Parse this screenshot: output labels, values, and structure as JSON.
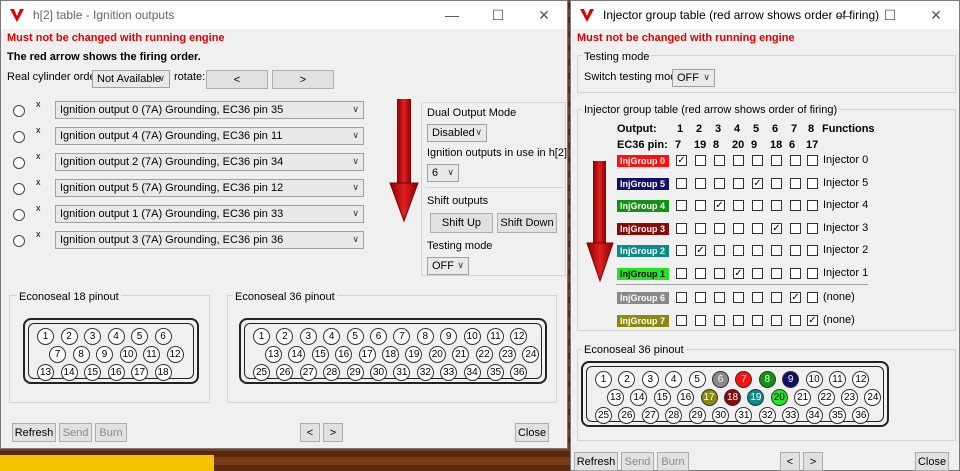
{
  "colors": {
    "warning": "#e00000",
    "arrow": "#c00000",
    "yellow": "#f4c400"
  },
  "left": {
    "title": "h[2] table - Ignition outputs",
    "warning": "Must not be changed with running engine",
    "firing_note": "The red arrow shows the firing order.",
    "real_cyl_label": "Real cylinder order:",
    "real_cyl_value": "Not Available",
    "rotate_label": "rotate:",
    "rotate_left": "<",
    "rotate_right": ">",
    "x_mark": "x",
    "outputs": [
      "Ignition output 0 (7A) Grounding, EC36 pin 35",
      "Ignition output 4 (7A) Grounding, EC36 pin 11",
      "Ignition output 2 (7A) Grounding, EC36 pin 34",
      "Ignition output 5 (7A) Grounding, EC36 pin 12",
      "Ignition output 1 (7A) Grounding, EC36 pin 33",
      "Ignition output 3 (7A) Grounding, EC36 pin 36"
    ],
    "dual_output_label": "Dual Output Mode",
    "dual_output_value": "Disabled",
    "outputs_in_use_label": "Ignition outputs in use in h[2]",
    "outputs_in_use_value": "6",
    "shift_label": "Shift outputs",
    "shift_up": "Shift Up",
    "shift_down": "Shift Down",
    "testing_label": "Testing mode",
    "testing_value": "OFF",
    "ec18_label": "Econoseal 18 pinout",
    "ec36_label": "Econoseal 36 pinout",
    "refresh": "Refresh",
    "send": "Send",
    "burn": "Burn",
    "prev": "<",
    "next": ">",
    "close": "Close"
  },
  "right": {
    "title": "Injector group table (red arrow shows order of firing)",
    "warning": "Must not be changed with running engine",
    "testing_group": "Testing mode",
    "switch_label": "Switch testing mode",
    "switch_value": "OFF",
    "table_group": "Injector group table (red arrow shows order of firing)",
    "output_label": "Output:",
    "pin_label": "EC36 pin:",
    "functions_label": "Functions",
    "outputs": [
      "1",
      "2",
      "3",
      "4",
      "5",
      "6",
      "7",
      "8"
    ],
    "pins": [
      "7",
      "19",
      "8",
      "20",
      "9",
      "18",
      "6",
      "17"
    ],
    "rows": [
      {
        "name": "InjGroup 0",
        "color": "#ff1010",
        "checked": 0,
        "func": "Injector 0"
      },
      {
        "name": "InjGroup 5",
        "color": "#10106a",
        "checked": 4,
        "func": "Injector 5"
      },
      {
        "name": "InjGroup 4",
        "color": "#129212",
        "checked": 2,
        "func": "Injector 4"
      },
      {
        "name": "InjGroup 3",
        "color": "#8a0a0a",
        "checked": 5,
        "func": "Injector 3"
      },
      {
        "name": "InjGroup 2",
        "color": "#0e8a8a",
        "checked": 1,
        "func": "Injector 2"
      },
      {
        "name": "InjGroup 1",
        "color": "#22e622",
        "checked": 3,
        "func": "Injector 1"
      },
      {
        "name": "InjGroup 6",
        "color": "#8a8a8a",
        "checked": 6,
        "func": "(none)"
      },
      {
        "name": "InjGroup 7",
        "color": "#8a8a10",
        "checked": 7,
        "func": "(none)"
      }
    ],
    "ec36_label": "Econoseal 36 pinout",
    "refresh": "Refresh",
    "send": "Send",
    "burn": "Burn",
    "prev": "<",
    "next": ">",
    "close": "Close"
  },
  "ec18_pins": [
    "1",
    "2",
    "3",
    "4",
    "5",
    "6",
    "7",
    "8",
    "9",
    "10",
    "11",
    "12",
    "13",
    "14",
    "15",
    "16",
    "17",
    "18"
  ],
  "ec36_pins": [
    "1",
    "2",
    "3",
    "4",
    "5",
    "6",
    "7",
    "8",
    "9",
    "10",
    "11",
    "12",
    "13",
    "14",
    "15",
    "16",
    "17",
    "18",
    "19",
    "20",
    "21",
    "22",
    "23",
    "24",
    "25",
    "26",
    "27",
    "28",
    "29",
    "30",
    "31",
    "32",
    "33",
    "34",
    "35",
    "36"
  ],
  "right_pin_colors": {
    "6": "#8a8a8a",
    "7": "#ff1010",
    "8": "#129212",
    "9": "#10106a",
    "17": "#8a8a10",
    "18": "#8a0a0a",
    "19": "#0e8a8a",
    "20": "#22e622"
  }
}
